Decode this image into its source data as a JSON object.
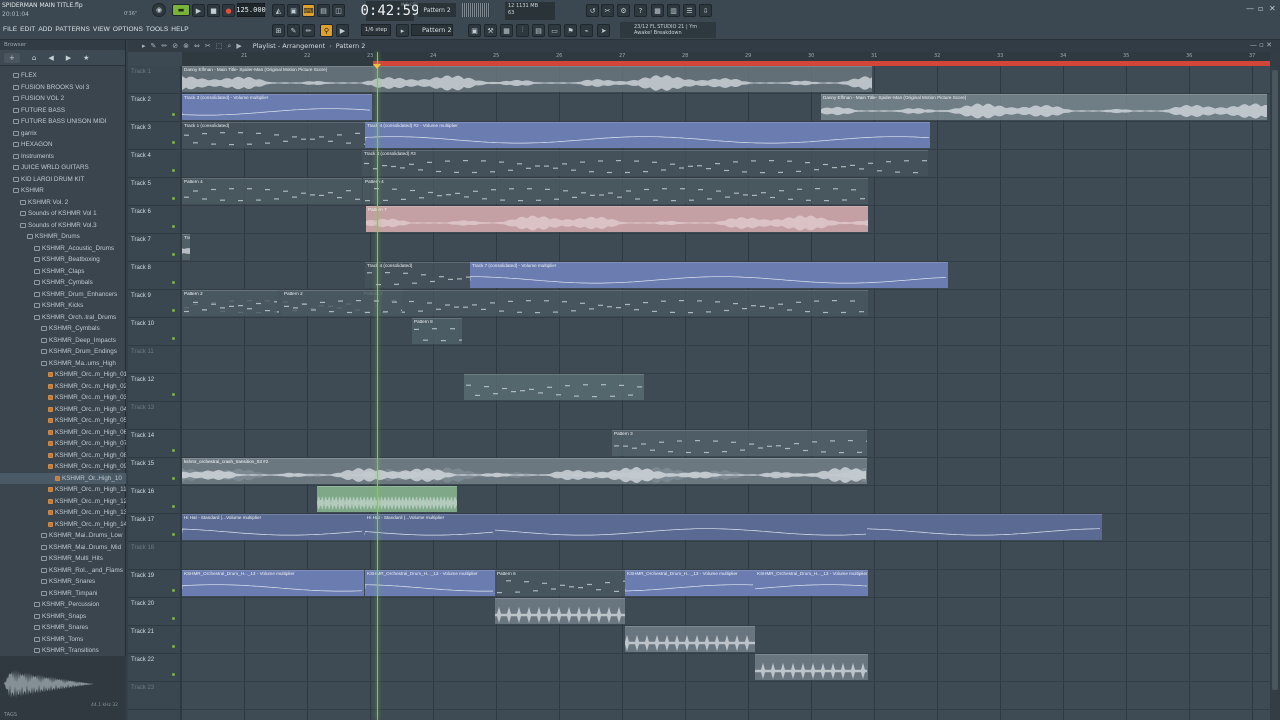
{
  "app": {
    "project_title": "SPIDERMAN MAIN TITLE.flp",
    "project_time": "20:01:04",
    "menu": [
      "FILE",
      "EDIT",
      "ADD",
      "PATTERNS",
      "VIEW",
      "OPTIONS",
      "TOOLS",
      "HELP"
    ]
  },
  "transport": {
    "bpm": "125.000",
    "clock": "0:42:59",
    "clock_sub": "M:S:CS",
    "pattern": "Pattern 2",
    "step": "1/6 step",
    "cpu_line1": "12        1131 MB",
    "cpu_line2": "                63",
    "hint_line1": "23/12  FL STUDIO 21 | Ym",
    "hint_line2": "Awake! Breakdown",
    "small_readout": "0'36\""
  },
  "browser": {
    "header": "Browser",
    "tools": [
      "+",
      "⌂",
      "◀",
      "▶",
      "★"
    ],
    "items": [
      {
        "label": "FLEX",
        "indent": 1,
        "type": "folder"
      },
      {
        "label": "FUSION BROOKS Vol 3",
        "indent": 1,
        "type": "folder"
      },
      {
        "label": "FUSION VOL 2",
        "indent": 1,
        "type": "folder"
      },
      {
        "label": "FUTURE BASS",
        "indent": 1,
        "type": "folder"
      },
      {
        "label": "FUTURE BASS UNISON MIDI",
        "indent": 1,
        "type": "folder"
      },
      {
        "label": "garrix",
        "indent": 1,
        "type": "folder"
      },
      {
        "label": "HEXAGON",
        "indent": 1,
        "type": "folder"
      },
      {
        "label": "Instruments",
        "indent": 1,
        "type": "folder"
      },
      {
        "label": "JUICE WRLD GUITARS",
        "indent": 1,
        "type": "folder"
      },
      {
        "label": "KID LAROI DRUM KIT",
        "indent": 1,
        "type": "folder"
      },
      {
        "label": "KSHMR",
        "indent": 1,
        "type": "folder"
      },
      {
        "label": "KSHMR Vol. 2",
        "indent": 2,
        "type": "folder"
      },
      {
        "label": "Sounds of KSHMR Vol 1",
        "indent": 2,
        "type": "folder"
      },
      {
        "label": "Sounds of KSHMR Vol.3",
        "indent": 2,
        "type": "folder"
      },
      {
        "label": "KSHMR_Drums",
        "indent": 3,
        "type": "folder"
      },
      {
        "label": "KSHMR_Acoustic_Drums",
        "indent": 4,
        "type": "folder"
      },
      {
        "label": "KSHMR_Beatboxing",
        "indent": 4,
        "type": "folder"
      },
      {
        "label": "KSHMR_Claps",
        "indent": 4,
        "type": "folder"
      },
      {
        "label": "KSHMR_Cymbals",
        "indent": 4,
        "type": "folder"
      },
      {
        "label": "KSHMR_Drum_Enhancers",
        "indent": 4,
        "type": "folder"
      },
      {
        "label": "KSHMR_Kicks",
        "indent": 4,
        "type": "folder"
      },
      {
        "label": "KSHMR_Orch..tral_Drums",
        "indent": 4,
        "type": "folder"
      },
      {
        "label": "KSHMR_Cymbals",
        "indent": 5,
        "type": "folder"
      },
      {
        "label": "KSHMR_Deep_Impacts",
        "indent": 5,
        "type": "folder"
      },
      {
        "label": "KSHMR_Drum_Endings",
        "indent": 5,
        "type": "folder"
      },
      {
        "label": "KSHMR_Ma..ums_High",
        "indent": 5,
        "type": "folder"
      },
      {
        "label": "KSHMR_Orc..m_High_01",
        "indent": 6,
        "type": "file"
      },
      {
        "label": "KSHMR_Orc..m_High_02",
        "indent": 6,
        "type": "file"
      },
      {
        "label": "KSHMR_Orc..m_High_03",
        "indent": 6,
        "type": "file"
      },
      {
        "label": "KSHMR_Orc..m_High_04",
        "indent": 6,
        "type": "file"
      },
      {
        "label": "KSHMR_Orc..m_High_05",
        "indent": 6,
        "type": "file"
      },
      {
        "label": "KSHMR_Orc..m_High_06",
        "indent": 6,
        "type": "file"
      },
      {
        "label": "KSHMR_Orc..m_High_07",
        "indent": 6,
        "type": "file"
      },
      {
        "label": "KSHMR_Orc..m_High_08",
        "indent": 6,
        "type": "file"
      },
      {
        "label": "KSHMR_Orc..m_High_09",
        "indent": 6,
        "type": "file"
      },
      {
        "label": "KSHMR_Or..High_10",
        "indent": 7,
        "type": "file"
      },
      {
        "label": "KSHMR_Orc..m_High_11",
        "indent": 6,
        "type": "file"
      },
      {
        "label": "KSHMR_Orc..m_High_12",
        "indent": 6,
        "type": "file"
      },
      {
        "label": "KSHMR_Orc..m_High_13",
        "indent": 6,
        "type": "file"
      },
      {
        "label": "KSHMR_Orc..m_High_14",
        "indent": 6,
        "type": "file"
      },
      {
        "label": "KSHMR_Mai..Drums_Low",
        "indent": 5,
        "type": "folder"
      },
      {
        "label": "KSHMR_Mai..Drums_Mid",
        "indent": 5,
        "type": "folder"
      },
      {
        "label": "KSHMR_Multi_Hits",
        "indent": 5,
        "type": "folder"
      },
      {
        "label": "KSHMR_Rol.._and_Flams",
        "indent": 5,
        "type": "folder"
      },
      {
        "label": "KSHMR_Snares",
        "indent": 5,
        "type": "folder"
      },
      {
        "label": "KSHMR_Timpani",
        "indent": 5,
        "type": "folder"
      },
      {
        "label": "KSHMR_Percussion",
        "indent": 4,
        "type": "folder"
      },
      {
        "label": "KSHMR_Snaps",
        "indent": 4,
        "type": "folder"
      },
      {
        "label": "KSHMR_Snares",
        "indent": 4,
        "type": "folder"
      },
      {
        "label": "KSHMR_Toms",
        "indent": 4,
        "type": "folder"
      },
      {
        "label": "KSHMR_Transitions",
        "indent": 4,
        "type": "folder"
      },
      {
        "label": "KSHMR_Drums_Loops",
        "indent": 3,
        "type": "folder"
      }
    ],
    "selected_index": 35,
    "tags_label": "TAGS",
    "file_size": "44.1 kHz 32"
  },
  "playlist": {
    "title": "Playlist - Arrangement",
    "pattern": "Pattern 2",
    "ticks": [
      "21",
      "22",
      "23",
      "24",
      "25",
      "26",
      "27",
      "28",
      "29",
      "30",
      "31",
      "32",
      "33",
      "34",
      "35",
      "36",
      "37"
    ],
    "tracks": [
      {
        "name": "Track 1",
        "dim": true
      },
      {
        "name": "Track 2",
        "dim": false
      },
      {
        "name": "Track 3",
        "dim": false
      },
      {
        "name": "Track 4",
        "dim": false
      },
      {
        "name": "Track 5",
        "dim": false
      },
      {
        "name": "Track 6",
        "dim": false
      },
      {
        "name": "Track 7",
        "dim": false
      },
      {
        "name": "Track 8",
        "dim": false
      },
      {
        "name": "Track 9",
        "dim": false
      },
      {
        "name": "Track 10",
        "dim": false
      },
      {
        "name": "Track 11",
        "dim": true
      },
      {
        "name": "Track 12",
        "dim": false
      },
      {
        "name": "Track 13",
        "dim": true
      },
      {
        "name": "Track 14",
        "dim": false
      },
      {
        "name": "Track 15",
        "dim": false
      },
      {
        "name": "Track 16",
        "dim": false
      },
      {
        "name": "Track 17",
        "dim": false
      },
      {
        "name": "Track 18",
        "dim": true
      },
      {
        "name": "Track 19",
        "dim": false
      },
      {
        "name": "Track 20",
        "dim": false
      },
      {
        "name": "Track 21",
        "dim": false
      },
      {
        "name": "Track 22",
        "dim": false
      },
      {
        "name": "Track 23",
        "dim": true
      }
    ],
    "clips": [
      {
        "row": 0,
        "label": "Danny Elfman - Main Title- Spider-Man (Original Motion Picture Score)",
        "kind": "audio",
        "color": "#6c7880"
      },
      {
        "row": 1,
        "label": "Track 3 (consolidated) - Volume multiplier",
        "kind": "auto",
        "color": "#6a7cb0"
      },
      {
        "row": 1,
        "label": "Danny Elfman - Main Title- Spider-Man (Original Motion Picture Score)",
        "kind": "audio",
        "color": "#7c8a90"
      },
      {
        "row": 2,
        "label": "Track 1 (consolidated)",
        "kind": "notes",
        "color": "#46535b"
      },
      {
        "row": 2,
        "label": "Track 4 (consolidated) #2 - Volume multiplier",
        "kind": "auto",
        "color": "#6a7cb0"
      },
      {
        "row": 3,
        "label": "Track 4 (consolidated) #3",
        "kind": "notes",
        "color": "#46535b"
      },
      {
        "row": 4,
        "label": "Pattern 4",
        "kind": "notes",
        "color": "#4c5a62"
      },
      {
        "row": 4,
        "label": "Pattern 4",
        "kind": "notes",
        "color": "#4c5a62"
      },
      {
        "row": 5,
        "label": "Pattern 7",
        "kind": "bright",
        "color": "#c4a0a4"
      },
      {
        "row": 6,
        "label": "Track 7 (consolidated)",
        "kind": "audio",
        "color": "#56646c"
      },
      {
        "row": 7,
        "label": "Track 4 (consolidated)",
        "kind": "notes",
        "color": "#46535b"
      },
      {
        "row": 7,
        "label": "Track 7 (consolidated) - Volume multiplier",
        "kind": "auto",
        "color": "#6a7cb0"
      },
      {
        "row": 8,
        "label": "Pattern 2",
        "kind": "notes",
        "color": "#4a5860"
      },
      {
        "row": 8,
        "label": "Pattern 2",
        "kind": "notes",
        "color": "#4a5860"
      },
      {
        "row": 8,
        "label": "Pattern 2",
        "kind": "notes",
        "color": "#4a5860"
      },
      {
        "row": 8,
        "label": "Pattern 2",
        "kind": "notes",
        "color": "#4a5860"
      },
      {
        "row": 9,
        "label": "Pattern 8",
        "kind": "notes",
        "color": "#4f6068"
      },
      {
        "row": 11,
        "label": "",
        "kind": "notes",
        "color": "#5a6e72"
      },
      {
        "row": 13,
        "label": "Pattern 3",
        "kind": "notes",
        "color": "#52626a"
      },
      {
        "row": 14,
        "label": "kshmr_orchestral_crash_transition_03",
        "kind": "audio",
        "color": "#6e7a82"
      },
      {
        "row": 14,
        "label": "kshmr_orchestral_crash_transition_03 #2",
        "kind": "audio",
        "color": "#6e7a82"
      },
      {
        "row": 15,
        "label": "",
        "kind": "dense",
        "color": "#7ea888"
      },
      {
        "row": 16,
        "label": "Hi Hat - Standard...olume multiplier",
        "kind": "auto",
        "color": "#5a6a92"
      },
      {
        "row": 16,
        "label": "Hi Hat - Standard (...Volume multiplier",
        "kind": "auto",
        "color": "#5a6a92"
      },
      {
        "row": 16,
        "label": "Hi Hat - Standard (...Volume multiplier",
        "kind": "auto",
        "color": "#5a6a92"
      },
      {
        "row": 16,
        "label": "Hi Hat - Standard (...Volume multiplier",
        "kind": "auto",
        "color": "#5a6a92"
      },
      {
        "row": 18,
        "label": "Pattern 6",
        "kind": "notes",
        "color": "#4a5860"
      },
      {
        "row": 18,
        "label": "KSHMR_Orchestral_Drum_H..._13 - Volume multiplier",
        "kind": "auto",
        "color": "#6a7cb0"
      },
      {
        "row": 18,
        "label": "KSHMR_Orchestral_Drum_H..._13 - Volume multiplier",
        "kind": "auto",
        "color": "#6a7cb0"
      },
      {
        "row": 18,
        "label": "KSHMR_Orchestral_Drum_H..._13 - Volume multiplier",
        "kind": "auto",
        "color": "#6a7cb0"
      },
      {
        "row": 18,
        "label": "KSHMR_Orchestral_Drum_H..._13 - Volume multiplier",
        "kind": "auto",
        "color": "#6a7cb0"
      },
      {
        "row": 19,
        "label": "",
        "kind": "hits",
        "color": "#74808a"
      },
      {
        "row": 20,
        "label": "",
        "kind": "hits",
        "color": "#74808a"
      },
      {
        "row": 21,
        "label": "",
        "kind": "hits",
        "color": "#74808a"
      }
    ]
  },
  "colors": {
    "accent": "#7cd046",
    "timeline_red": "#d2463a",
    "panel": "#3b4751"
  }
}
